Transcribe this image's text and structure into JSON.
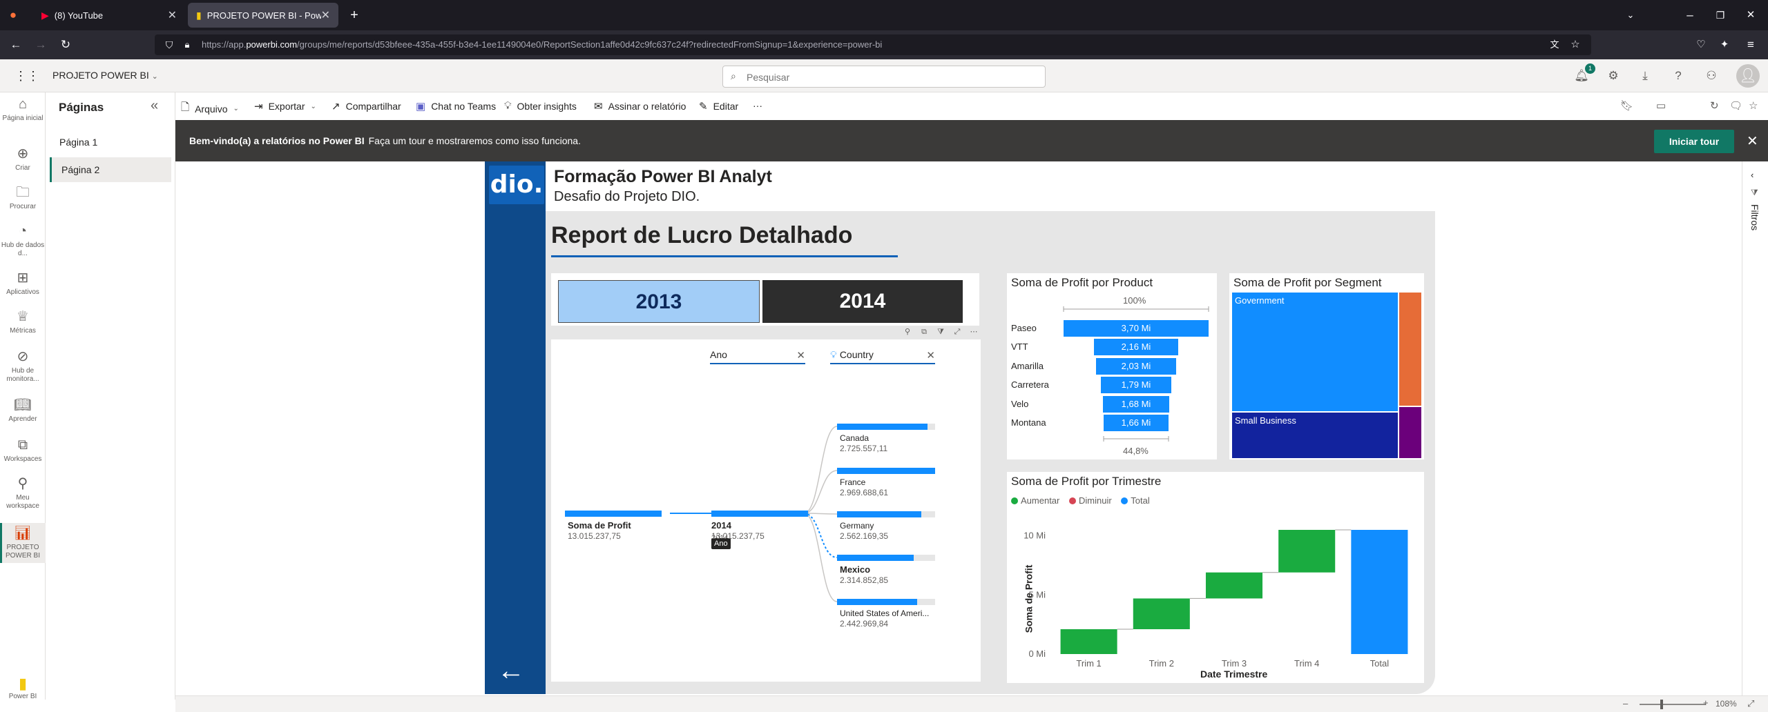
{
  "browser": {
    "tabs": [
      {
        "title": "(8) YouTube"
      },
      {
        "title": "PROJETO POWER BI - Power BI"
      }
    ],
    "url_prefix": "https://app.",
    "url_domain": "powerbi.com",
    "url_rest": "/groups/me/reports/d53bfeee-435a-455f-b3e4-1ee1149004e0/ReportSection1affe0d42c9fc637c24f?redirectedFromSignup=1&experience=power-bi"
  },
  "header": {
    "workspace_title": "PROJETO POWER BI",
    "search_placeholder": "Pesquisar",
    "notification_count": "1"
  },
  "leftnav": {
    "items": [
      {
        "label": "Página inicial"
      },
      {
        "label": "Criar"
      },
      {
        "label": "Procurar"
      },
      {
        "label": "Hub de dados d..."
      },
      {
        "label": "Aplicativos"
      },
      {
        "label": "Métricas"
      },
      {
        "label": "Hub de monitora..."
      },
      {
        "label": "Aprender"
      },
      {
        "label": "Workspaces"
      },
      {
        "label": "Meu workspace"
      },
      {
        "label": "PROJETO POWER BI"
      }
    ],
    "brand": "Power BI"
  },
  "pages": {
    "title": "Páginas",
    "items": [
      {
        "label": "Página 1"
      },
      {
        "label": "Página 2"
      }
    ]
  },
  "actionbar": {
    "file": "Arquivo",
    "export": "Exportar",
    "share": "Compartilhar",
    "teams": "Chat no Teams",
    "insights": "Obter insights",
    "subscribe": "Assinar o relatório",
    "edit": "Editar",
    "more": "···"
  },
  "banner": {
    "bold": "Bem-vindo(a) a relatórios no Power BI",
    "text": "Faça um tour e mostraremos como isso funciona.",
    "button": "Iniciar tour"
  },
  "filters_label": "Filtros",
  "report": {
    "logo": "dio.",
    "title": "Formação Power BI Analyt",
    "subtitle": "Desafio do Projeto DIO.",
    "heading": "Report de Lucro Detalhado",
    "year_slicer": [
      {
        "label": "2013",
        "selected": true
      },
      {
        "label": "2014",
        "selected": false
      }
    ],
    "decomposition_tree": {
      "level1_header": "Ano",
      "level2_header": "Country",
      "tooltip": "Ano",
      "tooltip_under": "2014",
      "root": {
        "label": "Soma de Profit",
        "value": "13.015.237,75"
      },
      "year_node": {
        "label": "2014",
        "value": "13.015.237,75"
      },
      "countries": [
        {
          "label": "Canada",
          "value": "2.725.557,11",
          "share": 0.92
        },
        {
          "label": "France",
          "value": "2.969.688,61",
          "share": 1.0
        },
        {
          "label": "Germany",
          "value": "2.562.169,35",
          "share": 0.86
        },
        {
          "label": "Mexico",
          "value": "2.314.852,85",
          "share": 0.78
        },
        {
          "label": "United States of Ameri...",
          "value": "2.442.969,84",
          "share": 0.82
        }
      ]
    }
  },
  "funnel": {
    "title": "Soma de Profit por Product",
    "top_pct": "100%",
    "bottom_pct": "44,8%",
    "items": [
      {
        "label": "Paseo",
        "value_label": "3,70 Mi",
        "share": 1.0
      },
      {
        "label": "VTT",
        "value_label": "2,16 Mi",
        "share": 0.584
      },
      {
        "label": "Amarilla",
        "value_label": "2,03 Mi",
        "share": 0.549
      },
      {
        "label": "Carretera",
        "value_label": "1,79 Mi",
        "share": 0.484
      },
      {
        "label": "Velo",
        "value_label": "1,68 Mi",
        "share": 0.454
      },
      {
        "label": "Montana",
        "value_label": "1,66 Mi",
        "share": 0.448
      }
    ]
  },
  "treemap": {
    "title": "Soma de Profit por Segment",
    "cells": [
      {
        "label": "Government",
        "color": "#118dff"
      },
      {
        "label": "Small Business",
        "color": "#12239e"
      },
      {
        "label": "",
        "color": "#e66c37"
      },
      {
        "label": "",
        "color": "#6b007b"
      }
    ]
  },
  "chart_data": {
    "type": "bar",
    "title": "Soma de Profit por Trimestre",
    "xlabel": "Date Trimestre",
    "ylabel": "Soma de Profit",
    "legend": [
      {
        "name": "Aumentar",
        "color": "#1aab40"
      },
      {
        "name": "Diminuir",
        "color": "#d64554"
      },
      {
        "name": "Total",
        "color": "#118dff"
      }
    ],
    "categories": [
      "Trim 1",
      "Trim 2",
      "Trim 3",
      "Trim 4",
      "Total"
    ],
    "values": [
      2.1,
      2.6,
      2.2,
      3.6,
      10.5
    ],
    "yticks": [
      "0 Mi",
      "5 Mi",
      "10 Mi"
    ],
    "ylim": [
      0,
      11.2
    ],
    "legend_position": "top-left"
  },
  "zoom": "108%"
}
